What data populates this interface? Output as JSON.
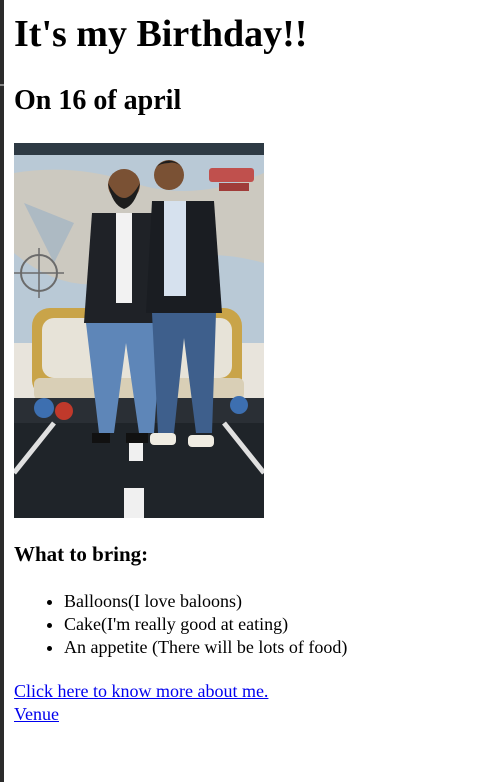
{
  "page": {
    "title": "It's my Birthday!!",
    "date_heading": "On 16 of april",
    "photo_description": "",
    "bring_heading": "What to bring:",
    "bring_items": [
      "Balloons(I love baloons)",
      "Cake(I'm really good at eating)",
      "An appetite (There will be lots of food)"
    ],
    "links": {
      "about": "Click here to know more about me.",
      "venue": "Venue"
    }
  },
  "colors": {
    "link": "#0000ee",
    "text": "#000000",
    "left_bar": "#2b2b2b"
  }
}
